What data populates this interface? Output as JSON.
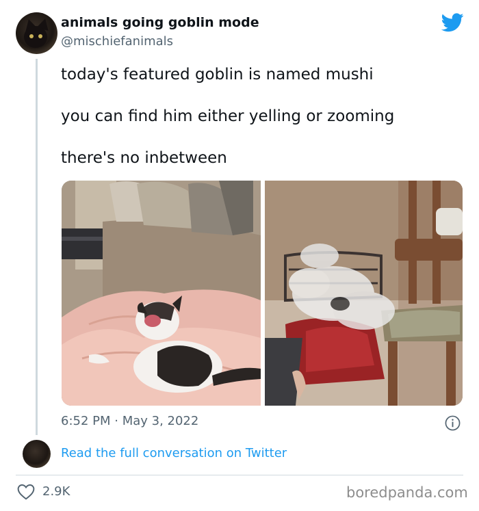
{
  "author": {
    "display_name": "animals going goblin mode",
    "handle": "@mischiefanimals"
  },
  "tweet": {
    "lines": [
      "today's featured goblin is named mushi",
      "you can find him either yelling or zooming",
      "there's no inbetween"
    ],
    "timestamp": "6:52 PM · May 3, 2022"
  },
  "footer": {
    "read_link": "Read the full conversation on Twitter",
    "like_count": "2.9K",
    "watermark": "boredpanda.com"
  },
  "icons": {
    "brand": "twitter-bird-icon",
    "info": "info-icon",
    "like": "heart-icon"
  },
  "colors": {
    "link": "#1d9bf0",
    "brand": "#1d9bf0",
    "secondary_text": "#536471"
  }
}
